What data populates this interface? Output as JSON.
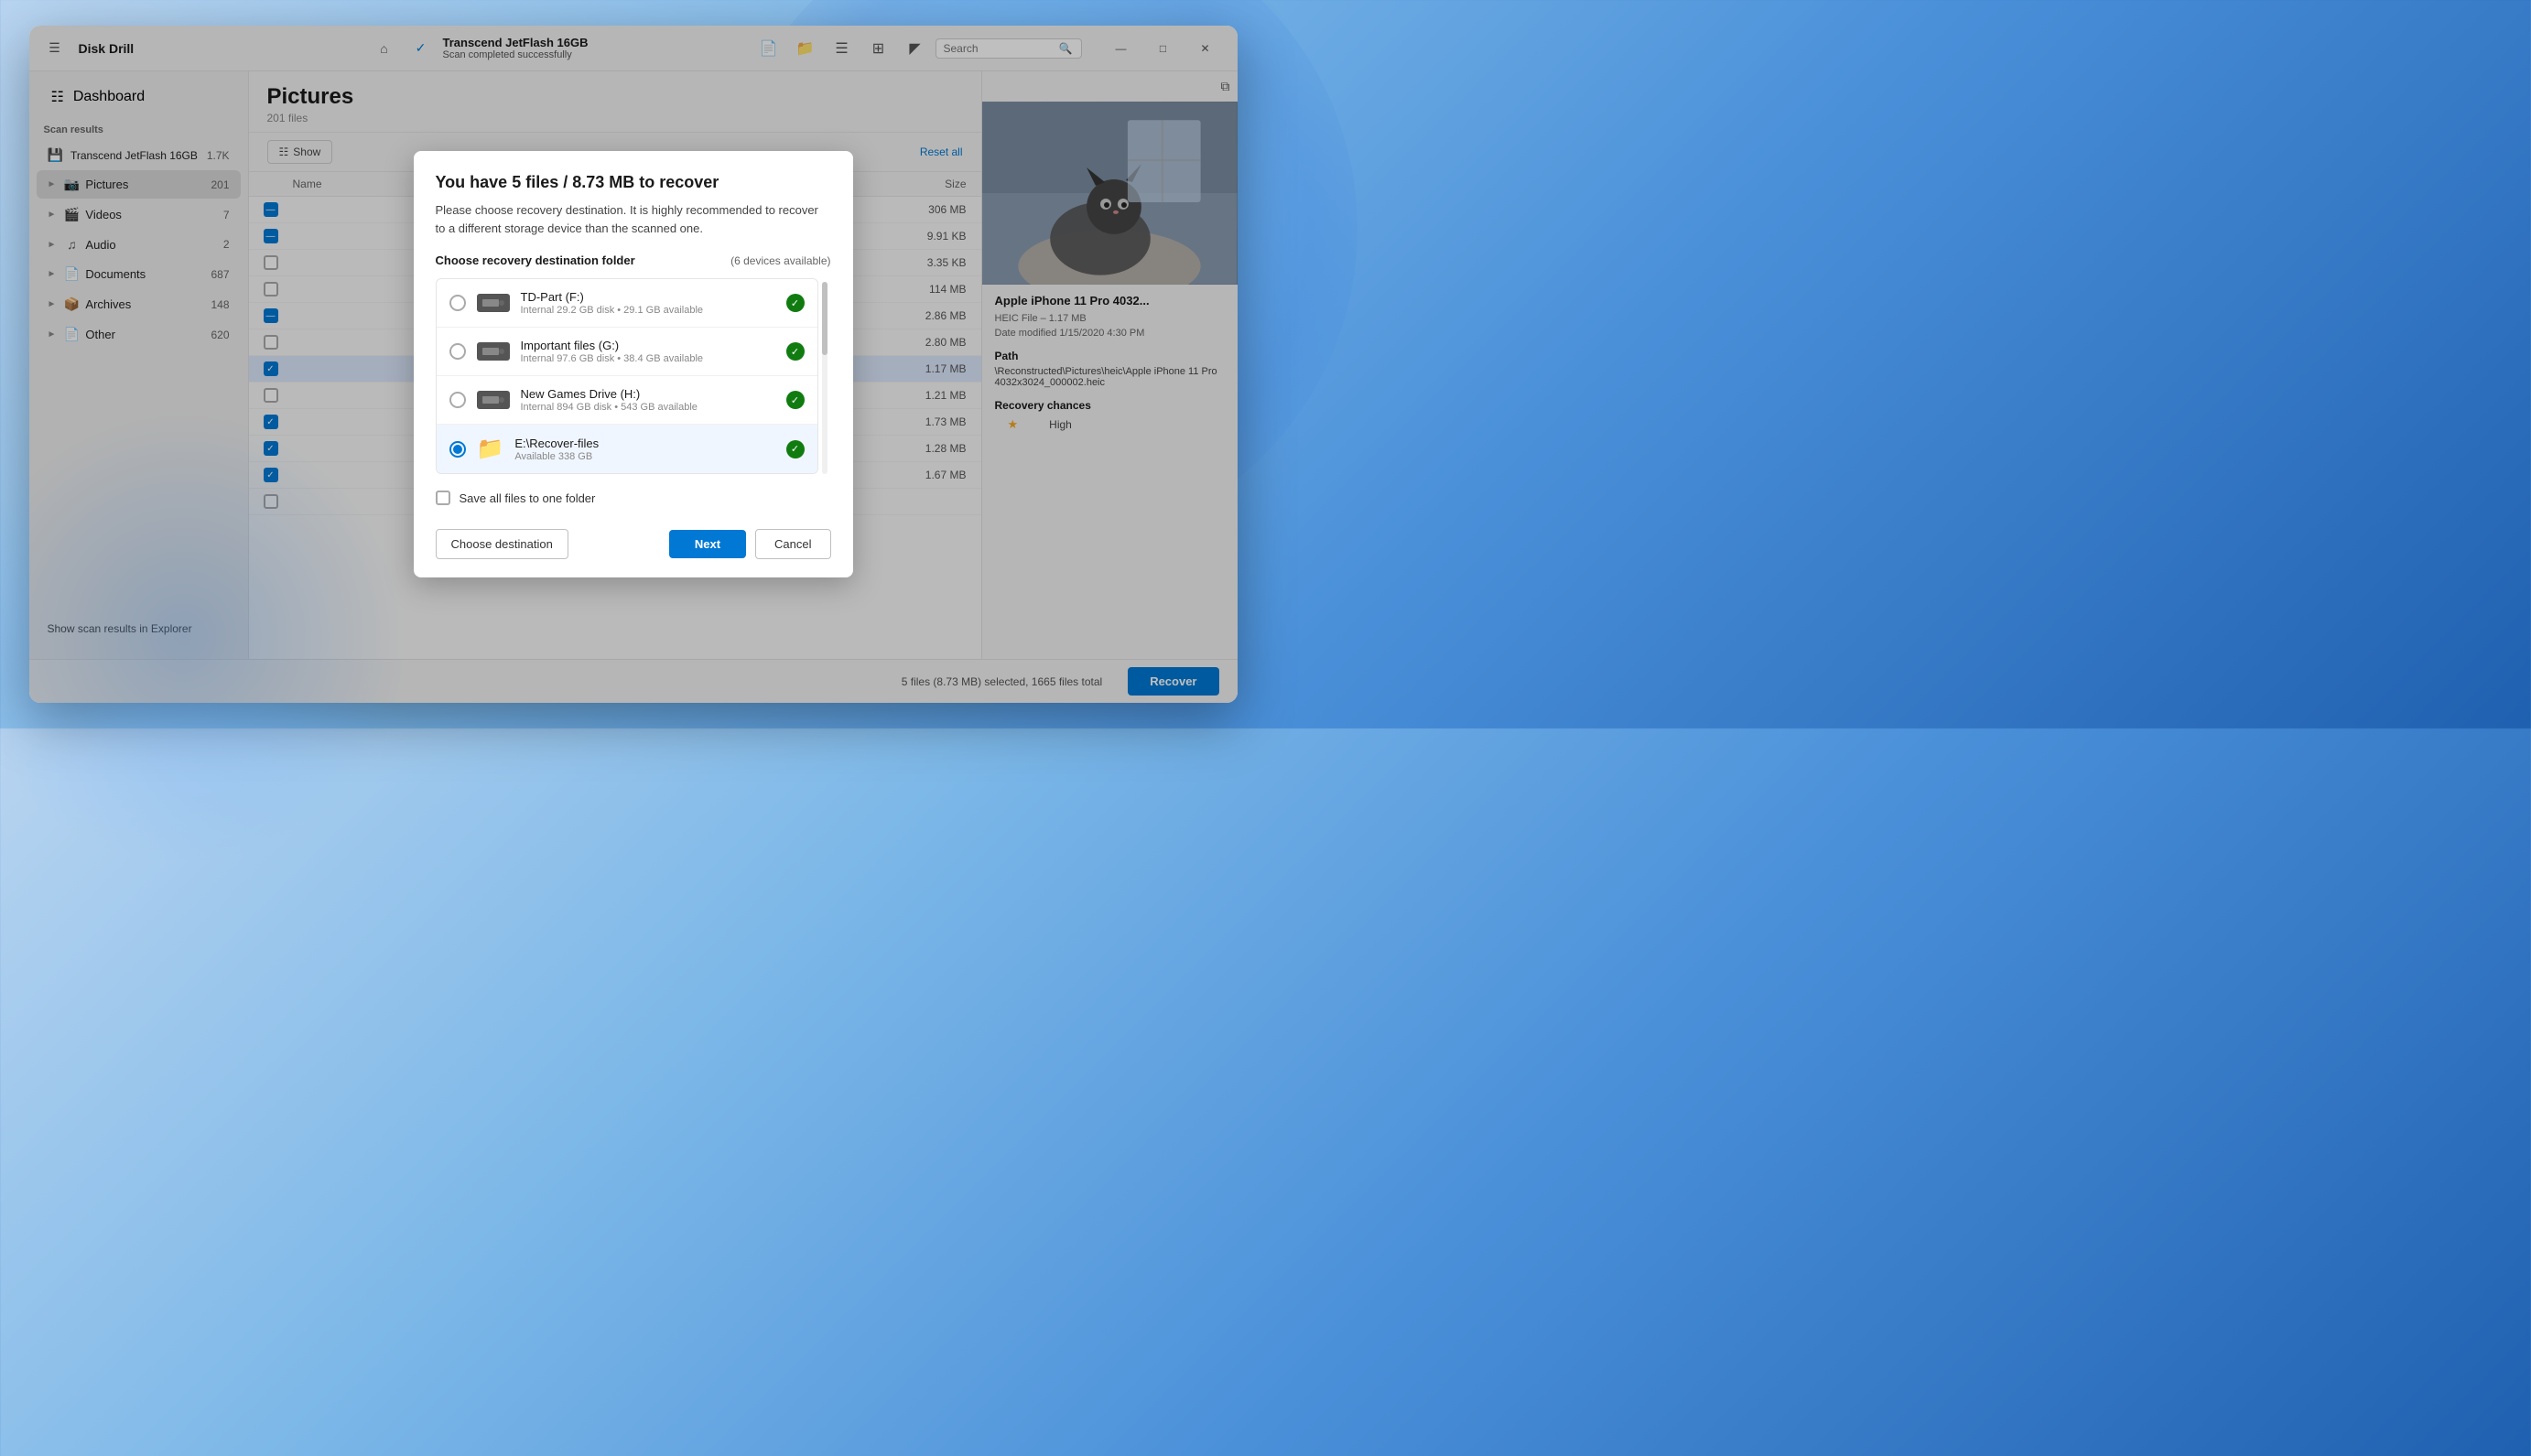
{
  "app": {
    "title": "Disk Drill",
    "drive_name": "Transcend JetFlash 16GB",
    "drive_status": "Scan completed successfully",
    "search_placeholder": "Search"
  },
  "sidebar": {
    "dashboard_label": "Dashboard",
    "scan_results_label": "Scan results",
    "drive_item": {
      "label": "Transcend JetFlash 16GB",
      "count": "1.7K"
    },
    "categories": [
      {
        "label": "Pictures",
        "count": "201",
        "active": true
      },
      {
        "label": "Videos",
        "count": "7",
        "active": false
      },
      {
        "label": "Audio",
        "count": "2",
        "active": false
      },
      {
        "label": "Documents",
        "count": "687",
        "active": false
      },
      {
        "label": "Archives",
        "count": "148",
        "active": false
      },
      {
        "label": "Other",
        "count": "620",
        "active": false
      }
    ],
    "show_scan_btn": "Show scan results in Explorer"
  },
  "main": {
    "title": "Pictures",
    "subtitle": "201 files",
    "show_label": "Show",
    "reset_all": "Reset all",
    "columns": {
      "name": "Name",
      "size": "Size"
    },
    "files": [
      {
        "checked": "minus",
        "size": "306 MB"
      },
      {
        "checked": "minus",
        "size": "9.91 KB"
      },
      {
        "checked": "unchecked",
        "size": "3.35 KB"
      },
      {
        "checked": "unchecked",
        "size": "114 MB"
      },
      {
        "checked": "minus",
        "size": "2.86 MB"
      },
      {
        "checked": "unchecked",
        "size": "2.80 MB"
      },
      {
        "checked": "checked",
        "size": "1.17 MB",
        "highlighted": true
      },
      {
        "checked": "unchecked",
        "size": "1.21 MB"
      },
      {
        "checked": "checked",
        "size": "1.73 MB"
      },
      {
        "checked": "checked",
        "size": "1.28 MB"
      },
      {
        "checked": "checked",
        "size": "1.67 MB"
      },
      {
        "checked": "unchecked",
        "size": ""
      }
    ]
  },
  "preview": {
    "filename": "Apple iPhone 11 Pro 4032...",
    "filetype": "HEIC File – 1.17 MB",
    "date_modified": "Date modified 1/15/2020 4:30 PM",
    "path_label": "Path",
    "path_value": "\\Reconstructed\\Pictures\\heic\\Apple iPhone 11 Pro 4032x3024_000002.heic",
    "recovery_chances_label": "Recovery chances",
    "recovery_stars": "★",
    "recovery_level": "High"
  },
  "bottom_bar": {
    "status": "5 files (8.73 MB) selected, 1665 files total",
    "recover_label": "Recover"
  },
  "modal": {
    "title": "You have 5 files / 8.73 MB to recover",
    "description": "Please choose recovery destination. It is highly recommended to recover to a different storage device than the scanned one.",
    "section_title": "Choose recovery destination folder",
    "devices_count": "(6 devices available)",
    "devices": [
      {
        "name": "TD-Part (F:)",
        "detail": "Internal 29.2 GB disk • 29.1 GB available",
        "type": "drive",
        "selected": false,
        "ok": true
      },
      {
        "name": "Important files (G:)",
        "detail": "Internal 97.6 GB disk • 38.4 GB available",
        "type": "drive",
        "selected": false,
        "ok": true
      },
      {
        "name": "New Games Drive (H:)",
        "detail": "Internal 894 GB disk • 543 GB available",
        "type": "drive",
        "selected": false,
        "ok": true
      },
      {
        "name": "E:\\Recover-files",
        "detail": "Available 338 GB",
        "type": "folder",
        "selected": true,
        "ok": true
      }
    ],
    "save_one_folder_label": "Save all files to one folder",
    "choose_destination_label": "Choose destination",
    "next_label": "Next",
    "cancel_label": "Cancel"
  }
}
